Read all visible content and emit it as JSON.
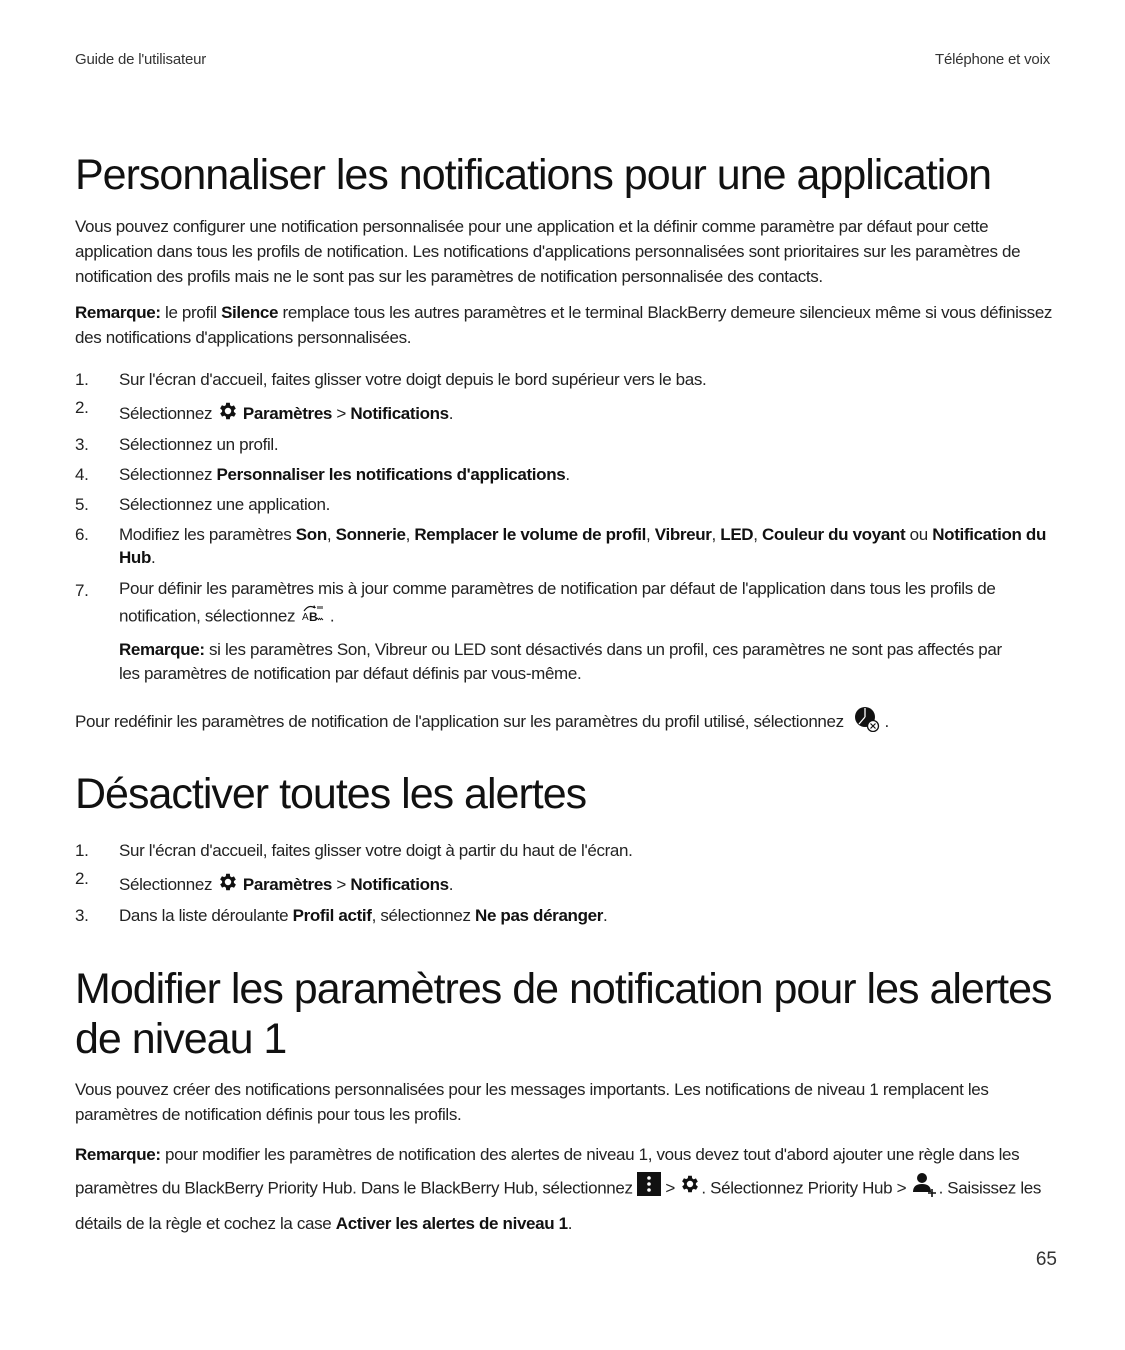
{
  "header": {
    "left": "Guide de l'utilisateur",
    "right": "Téléphone et voix"
  },
  "section1": {
    "title": "Personnaliser les notifications pour une application",
    "intro": "Vous pouvez configurer une notification personnalisée pour une application et la définir comme paramètre par défaut pour cette application dans tous les profils de notification. Les notifications d'applications personnalisées sont prioritaires sur les paramètres de notification des profils mais ne le sont pas sur les paramètres de notification personnalisée des contacts.",
    "note": {
      "label": "Remarque:",
      "t1": " le profil ",
      "b1": "Silence",
      "t2": " remplace tous les autres paramètres et le terminal BlackBerry demeure silencieux même si vous définissez des notifications d'applications personnalisées."
    },
    "steps": [
      {
        "num": "1.",
        "text": "Sur l'écran d'accueil, faites glisser votre doigt depuis le bord supérieur vers le bas."
      },
      {
        "num": "2.",
        "t1": "Sélectionnez ",
        "icon": "gear-icon",
        "b1": "Paramètres",
        "t2": " > ",
        "b2": "Notifications",
        "t3": "."
      },
      {
        "num": "3.",
        "text": "Sélectionnez un profil."
      },
      {
        "num": "4.",
        "t1": "Sélectionnez ",
        "b1": "Personnaliser les notifications d'applications",
        "t2": "."
      },
      {
        "num": "5.",
        "text": "Sélectionnez une application."
      },
      {
        "num": "6.",
        "t1": "Modifiez les paramètres ",
        "b1": "Son",
        "s1": ", ",
        "b2": "Sonnerie",
        "s2": ", ",
        "b3": "Remplacer le volume de profil",
        "s3": ", ",
        "b4": "Vibreur",
        "s4": ", ",
        "b5": "LED",
        "s5": ", ",
        "b6": "Couleur du voyant",
        "s6": " ou ",
        "b7": "Notification du Hub",
        "s7": "."
      },
      {
        "num": "7.",
        "t1": "Pour définir les paramètres mis à jour comme paramètres de notification par défaut de l'application dans tous les profils de notification, sélectionnez ",
        "icon": "apply-defaults-icon",
        "t2": " ."
      }
    ],
    "step7_note": {
      "label": "Remarque:",
      "text": " si les paramètres Son, Vibreur ou LED sont désactivés dans un profil, ces paramètres ne sont pas affectés par les paramètres de notification par défaut définis par vous-même."
    },
    "reset": {
      "t1": "Pour redéfinir les paramètres de notification de l'application sur les paramètres du profil utilisé, sélectionnez ",
      "icon": "reset-profile-icon",
      "t2": " ."
    }
  },
  "section2": {
    "title": "Désactiver toutes les alertes",
    "steps": [
      {
        "num": "1.",
        "text": "Sur l'écran d'accueil, faites glisser votre doigt à partir du haut de l'écran."
      },
      {
        "num": "2.",
        "t1": "Sélectionnez ",
        "icon": "gear-icon",
        "b1": "Paramètres",
        "t2": " > ",
        "b2": "Notifications",
        "t3": "."
      },
      {
        "num": "3.",
        "t1": "Dans la liste déroulante ",
        "b1": "Profil actif",
        "t2": ", sélectionnez ",
        "b2": "Ne pas déranger",
        "t3": "."
      }
    ]
  },
  "section3": {
    "title_line1": "Modifier les paramètres de notification pour les alertes",
    "title_line2": "de niveau 1",
    "intro": "Vous pouvez créer des notifications personnalisées pour les messages importants. Les notifications de niveau 1 remplacent les paramètres de notification définis pour tous les profils.",
    "note": {
      "label": "Remarque:",
      "t1": " pour modifier les paramètres de notification des alertes de niveau 1, vous devez tout d'abord ajouter une règle dans les paramètres du BlackBerry Priority Hub. Dans le BlackBerry Hub, sélectionnez ",
      "icon1": "menu-more-icon",
      "t2": " > ",
      "icon2": "gear-icon",
      "t3": ". Sélectionnez Priority Hub > ",
      "icon3": "add-contact-icon",
      "t4": ". Saisissez les détails de la règle et cochez la case ",
      "b1": "Activer les alertes de niveau 1",
      "t5": "."
    }
  },
  "footer": {
    "page_number": "65"
  }
}
